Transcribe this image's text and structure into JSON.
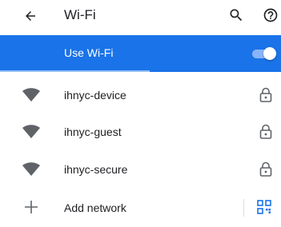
{
  "header": {
    "title": "Wi-Fi",
    "icons": [
      "back-arrow-icon",
      "search-icon",
      "help-icon"
    ]
  },
  "master_toggle": {
    "label": "Use Wi-Fi",
    "enabled": true
  },
  "networks": [
    {
      "ssid": "ihnyc-device",
      "secured": true
    },
    {
      "ssid": "ihnyc-guest",
      "secured": true
    },
    {
      "ssid": "ihnyc-secure",
      "secured": true
    }
  ],
  "add_network": {
    "label": "Add network",
    "icons": [
      "plus-icon",
      "qr-code-scanner-icon"
    ]
  },
  "colors": {
    "accent": "#1a73e8",
    "toggle_track": "#8ab4f8",
    "icon_gray": "#5f6368",
    "wifi_icon": "#5f6368"
  }
}
